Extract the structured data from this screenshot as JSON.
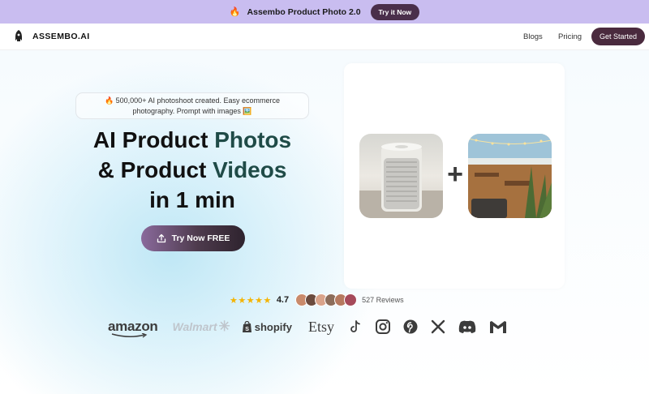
{
  "announcement": {
    "emoji": "🔥",
    "text": "Assembo Product Photo 2.0",
    "button": "Try it Now"
  },
  "nav": {
    "brand": "ASSEMBO.AI",
    "links": [
      "Blogs",
      "Pricing"
    ],
    "cta": "Get Started"
  },
  "hero": {
    "tagline_line1": "🔥 500,000+ AI photoshoot created. Easy ecommerce",
    "tagline_line2": "photography. Prompt with images 🖼️",
    "headline": {
      "line1_a": "AI Product ",
      "line1_b": "Photos",
      "line2_a": "& Product ",
      "line2_b": "Videos",
      "line3": "in 1 min"
    },
    "cta": "Try Now FREE"
  },
  "reviews": {
    "stars": "★★★★★",
    "rating": "4.7",
    "count_label": "527 Reviews",
    "avatar_colors": [
      "#c98a6b",
      "#6b4b3e",
      "#d9a38a",
      "#8c6d5a",
      "#b5795f",
      "#a54a5a"
    ]
  },
  "logos": {
    "amazon": "amazon",
    "walmart": "Walmart",
    "shopify": "shopify",
    "etsy": "Etsy",
    "socials": [
      "tiktok-icon",
      "instagram-icon",
      "pinterest-icon",
      "x-icon",
      "discord-icon",
      "gmail-icon"
    ]
  },
  "colors": {
    "accent": "#4a2a3e",
    "announce_bg": "#c9bdf0",
    "headline_accent": "#1f4b47"
  }
}
